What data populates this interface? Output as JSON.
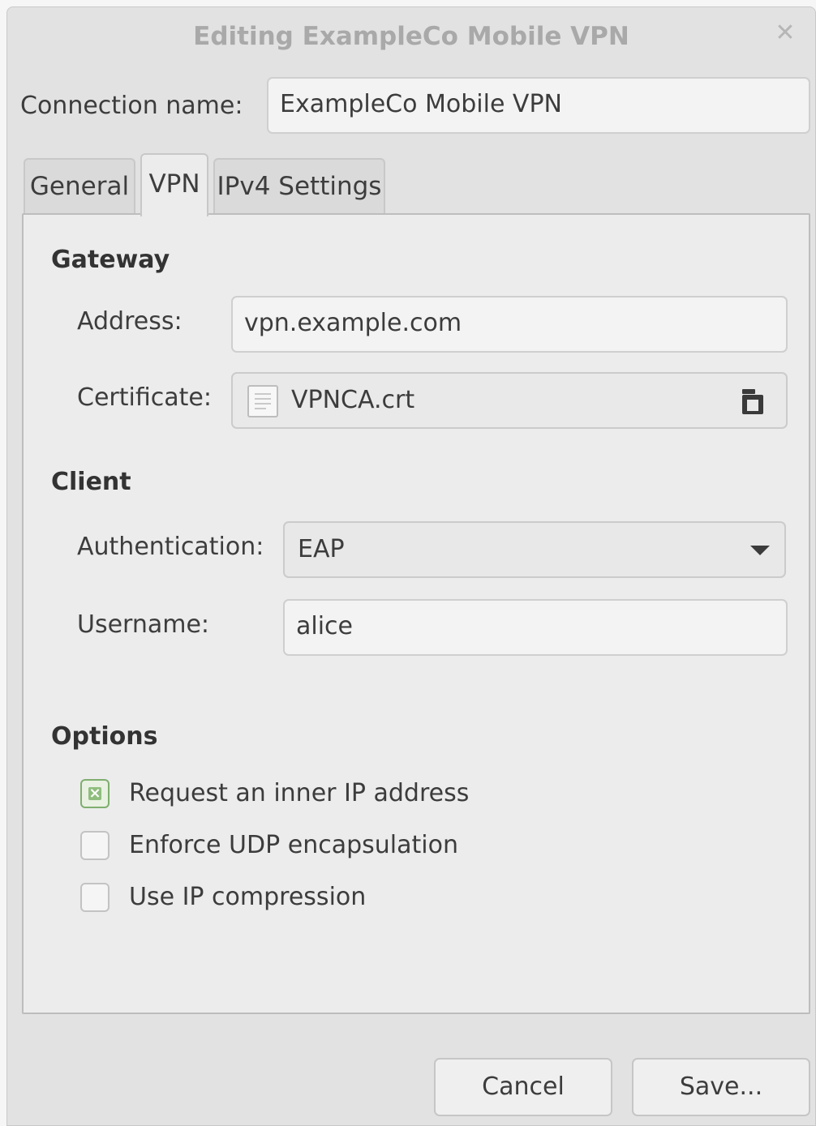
{
  "window": {
    "title": "Editing ExampleCo Mobile VPN",
    "close_glyph": "✕"
  },
  "connection": {
    "label": "Connection name:",
    "value": "ExampleCo Mobile VPN"
  },
  "tabs": [
    {
      "label": "General",
      "selected": false
    },
    {
      "label": "VPN",
      "selected": true
    },
    {
      "label": "IPv4 Settings",
      "selected": false
    }
  ],
  "gateway": {
    "heading": "Gateway",
    "address_label": "Address:",
    "address_value": "vpn.example.com",
    "certificate_label": "Certificate:",
    "certificate_file": "VPNCA.crt",
    "certificate_icon": "text-file-icon",
    "browse_icon": "folder-icon"
  },
  "client": {
    "heading": "Client",
    "auth_label": "Authentication:",
    "auth_value": "EAP",
    "username_label": "Username:",
    "username_value": "alice"
  },
  "options": {
    "heading": "Options",
    "items": [
      {
        "label": "Request an inner IP address",
        "checked": true
      },
      {
        "label": "Enforce UDP encapsulation",
        "checked": false
      },
      {
        "label": "Use IP compression",
        "checked": false
      }
    ]
  },
  "buttons": {
    "cancel": "Cancel",
    "save": "Save..."
  },
  "colors": {
    "check_accent": "#8fbd7e",
    "title_text": "#a9a9a9"
  }
}
